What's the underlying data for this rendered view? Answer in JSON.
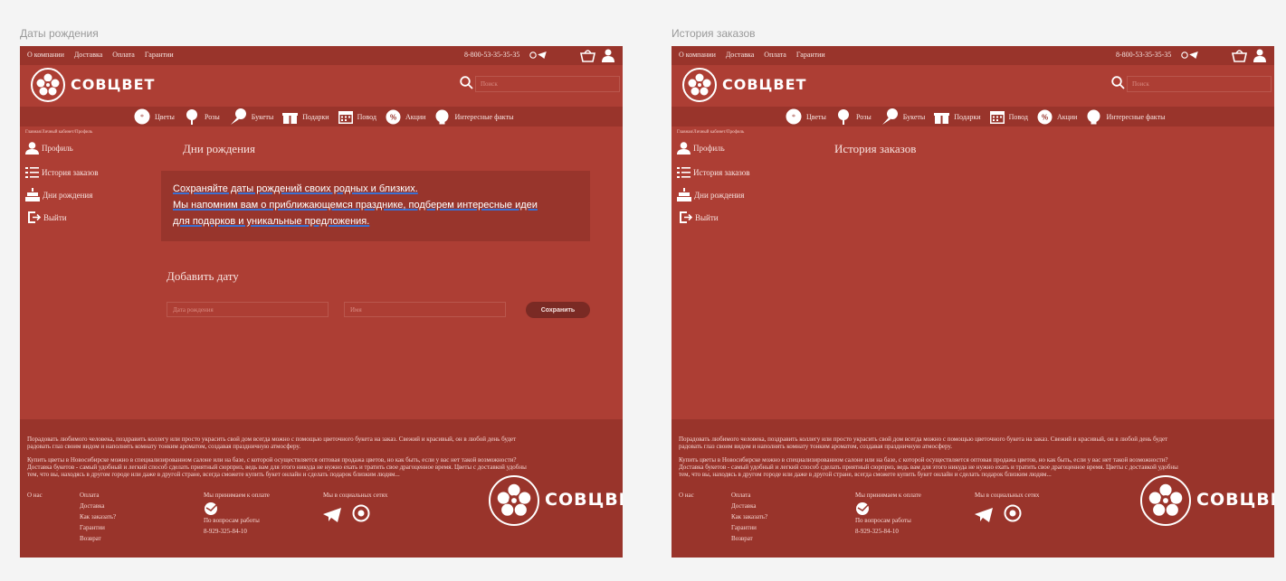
{
  "frames": [
    {
      "label": "Даты рождения",
      "page_title": "Дни рождения",
      "info_lines": [
        "Сохраняйте даты рождений своих родных и близких.",
        "Мы напомним вам о приближающемся празднике, подберем интересные идеи",
        "для подарков и уникальные предложения."
      ],
      "add_title": "Добавить дату",
      "date_placeholder": "Дата рождения",
      "name_placeholder": "Имя",
      "save_label": "Сохранить"
    },
    {
      "label": "История заказов",
      "page_title": "История заказов"
    }
  ],
  "topbar": {
    "nav": [
      "О компании",
      "Доставка",
      "Оплата",
      "Гарантии"
    ],
    "phone": "8-800-53-35-35-35"
  },
  "header": {
    "logo_text": "СОВЦВЕТ",
    "search_placeholder": "Поиск"
  },
  "categories": [
    {
      "label": "Цветы",
      "icon": "flower-icon"
    },
    {
      "label": "Розы",
      "icon": "rose-icon"
    },
    {
      "label": "Букеты",
      "icon": "bouquet-icon"
    },
    {
      "label": "Подарки",
      "icon": "gift-icon"
    },
    {
      "label": "Повод",
      "icon": "calendar-icon"
    },
    {
      "label": "Акции",
      "icon": "percent-icon"
    },
    {
      "label": "Интересные факты",
      "icon": "bulb-icon"
    }
  ],
  "breadcrumb": "Главная/Личный кабинет/Профиль",
  "sidebar": [
    {
      "label": "Профиль",
      "icon": "user-icon"
    },
    {
      "label": "История заказов",
      "icon": "list-icon"
    },
    {
      "label": "Дни рождения",
      "icon": "cake-icon"
    },
    {
      "label": "Выйти",
      "icon": "logout-icon"
    }
  ],
  "footer": {
    "para1_line1": "Порадовать любимого человека, поздравить коллегу или просто украсить свой дом всегда можно с помощью цветочного букета на заказ. Свежий и красивый, он в любой день будет",
    "para1_line2": "радовать глаз своим видом и наполнять комнату тонким ароматом, создавая праздничную атмосферу.",
    "para2_line1": "Купить цветы в Новосибирске можно в специализированном салоне или на базе, с которой осуществляется оптовая продажа цветов, но как быть, если у вас нет такой возможности?",
    "para2_line2": "Доставка букетов - самый удобный и легкий способ сделать приятный сюрприз, ведь вам для этого никуда не нужно ехать и тратить свое драгоценное время. Цветы с доставкой удобны",
    "para2_line3": "тем, что вы, находясь в другом городе или даже в другой стране, всегда сможете купить букет онлайн и сделать подарок близким людям...",
    "about": "О нас",
    "links": [
      "Оплата",
      "Доставка",
      "Как заказать?",
      "Гарантии",
      "Возврат"
    ],
    "payment_title": "Мы принимаем к оплате",
    "work_title": "По вопросам работы",
    "work_phone": "8-929-325-84-10",
    "social_title": "Мы в социальных сетях",
    "logo_text": "СОВЦВЕТ"
  }
}
